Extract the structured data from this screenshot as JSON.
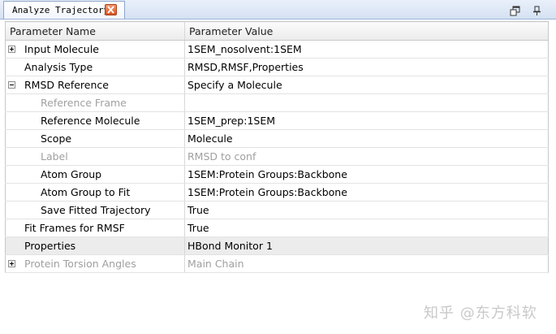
{
  "window": {
    "tab_title": "Analyze Trajectory",
    "icons": [
      "close-icon",
      "restore-icon",
      "pin-icon"
    ]
  },
  "grid": {
    "columns": [
      "Parameter Name",
      "Parameter Value"
    ],
    "rows": [
      {
        "name": "Input Molecule",
        "value": "1SEM_nosolvent:1SEM",
        "expander": "plus",
        "disabled": false
      },
      {
        "name": "Analysis Type",
        "value": "RMSD,RMSF,Properties",
        "expander": "none",
        "disabled": false
      },
      {
        "name": "RMSD Reference",
        "value": "Specify a Molecule",
        "expander": "minus",
        "disabled": false
      },
      {
        "name": "Reference Frame",
        "value": "",
        "expander": "none",
        "disabled": true
      },
      {
        "name": "Reference Molecule",
        "value": "1SEM_prep:1SEM",
        "expander": "none",
        "disabled": false
      },
      {
        "name": "Scope",
        "value": "Molecule",
        "expander": "none",
        "disabled": false
      },
      {
        "name": "Label",
        "value": "RMSD to conf",
        "expander": "none",
        "disabled": true
      },
      {
        "name": "Atom Group",
        "value": "1SEM:Protein Groups:Backbone",
        "expander": "none",
        "disabled": false
      },
      {
        "name": "Atom Group to Fit",
        "value": "1SEM:Protein Groups:Backbone",
        "expander": "none",
        "disabled": false
      },
      {
        "name": "Save Fitted Trajectory",
        "value": "True",
        "expander": "none",
        "disabled": false
      },
      {
        "name": "Fit Frames for RMSF",
        "value": "True",
        "expander": "none",
        "disabled": false
      },
      {
        "name": "Properties",
        "value": "HBond Monitor 1",
        "expander": "none",
        "disabled": false
      },
      {
        "name": "Protein Torsion Angles",
        "value": "Main Chain",
        "expander": "plus",
        "disabled": true
      }
    ]
  },
  "watermark": "知乎 @东方科软",
  "colors": {
    "tab_close": "#e06a35",
    "disabled_text": "#a0a0a0",
    "selected_row": "#ececec",
    "grid_border": "#c8c8c8"
  }
}
